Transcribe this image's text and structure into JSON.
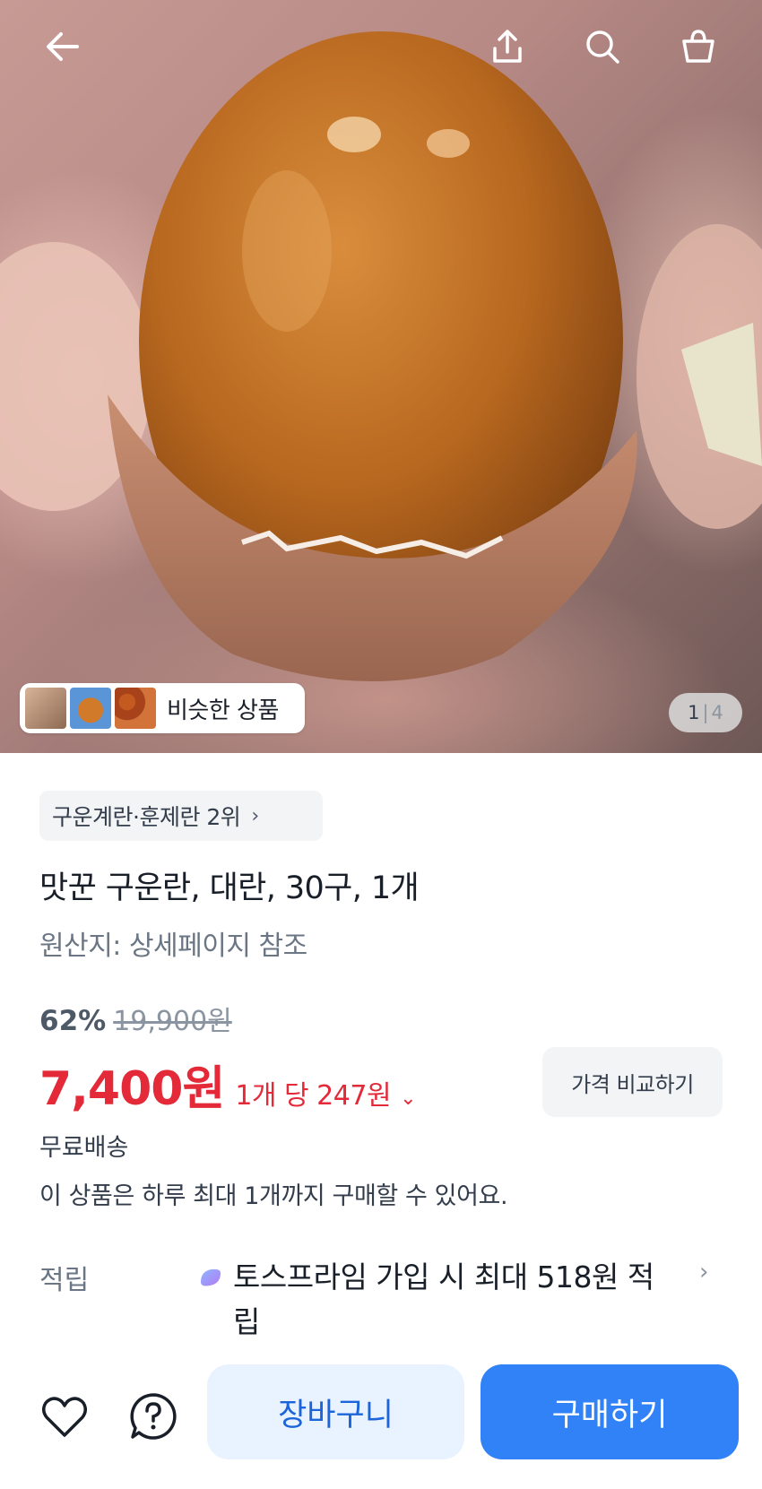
{
  "topbar": {
    "back_icon": "arrow-left-icon",
    "share_icon": "share-upload-icon",
    "search_icon": "search-icon",
    "bag_icon": "shopping-bag-icon"
  },
  "gallery": {
    "similar_label": "비슷한 상품",
    "current_page": "1",
    "separator": "|",
    "total_pages": "4"
  },
  "product": {
    "rank_badge": "구운계란·훈제란 2위",
    "title": "맛꾼 구운란, 대란, 30구, 1개",
    "origin": "원산지: 상세페이지 참조",
    "discount_rate": "62%",
    "original_price": "19,900원",
    "sale_price": "7,400원",
    "unit_price": "1개 당 247원",
    "compare_button": "가격 비교하기",
    "shipping": "무료배송",
    "purchase_limit": "이 상품은 하루 최대 1개까지 구매할 수 있어요."
  },
  "reward": {
    "label": "적립",
    "text": "토스프라임 가입 시 최대 518원 적립"
  },
  "bottombar": {
    "cart_button": "장바구니",
    "buy_button": "구매하기"
  },
  "colors": {
    "accent_blue": "#3182f6",
    "sale_red": "#e42939",
    "cart_bg": "#e8f3ff"
  }
}
